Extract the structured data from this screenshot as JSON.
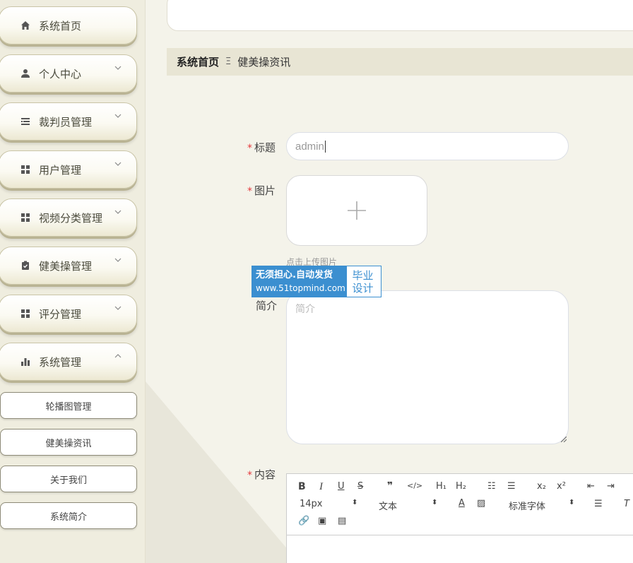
{
  "sidebar": {
    "items": [
      {
        "label": "系统首页",
        "icon": "home-icon",
        "chevron": "none"
      },
      {
        "label": "个人中心",
        "icon": "user-icon",
        "chevron": "down"
      },
      {
        "label": "裁判员管理",
        "icon": "list-icon",
        "chevron": "down"
      },
      {
        "label": "用户管理",
        "icon": "grid-icon",
        "chevron": "down"
      },
      {
        "label": "视频分类管理",
        "icon": "grid-icon",
        "chevron": "down"
      },
      {
        "label": "健美操管理",
        "icon": "clipboard-icon",
        "chevron": "down"
      },
      {
        "label": "评分管理",
        "icon": "grid-icon",
        "chevron": "down"
      },
      {
        "label": "系统管理",
        "icon": "bar-chart-icon",
        "chevron": "up"
      }
    ],
    "sub_items": [
      "轮播图管理",
      "健美操资讯",
      "关于我们",
      "系统简介"
    ]
  },
  "breadcrumb": {
    "home": "系统首页",
    "separator": "Ξ",
    "current": "健美操资讯"
  },
  "form": {
    "title_label": "标题",
    "title_value": "admin",
    "image_label": "图片",
    "upload_tip": "点击上传图片",
    "intro_label": "简介",
    "intro_placeholder": "简介",
    "content_label": "内容",
    "required_mark": "*"
  },
  "editor": {
    "font_size": "14px",
    "header_select": "文本",
    "font_family": "标准字体"
  },
  "watermark": {
    "line1": "无须担心.自动发货",
    "line2": "www.51topmind.com",
    "right1": "毕业",
    "right2": "设计"
  },
  "colors": {
    "accent": "#e4393c",
    "sidebar_bg": "#efeddf",
    "breadcrumb_bg": "#e8e5d4",
    "watermark": "#3b8fd0"
  }
}
